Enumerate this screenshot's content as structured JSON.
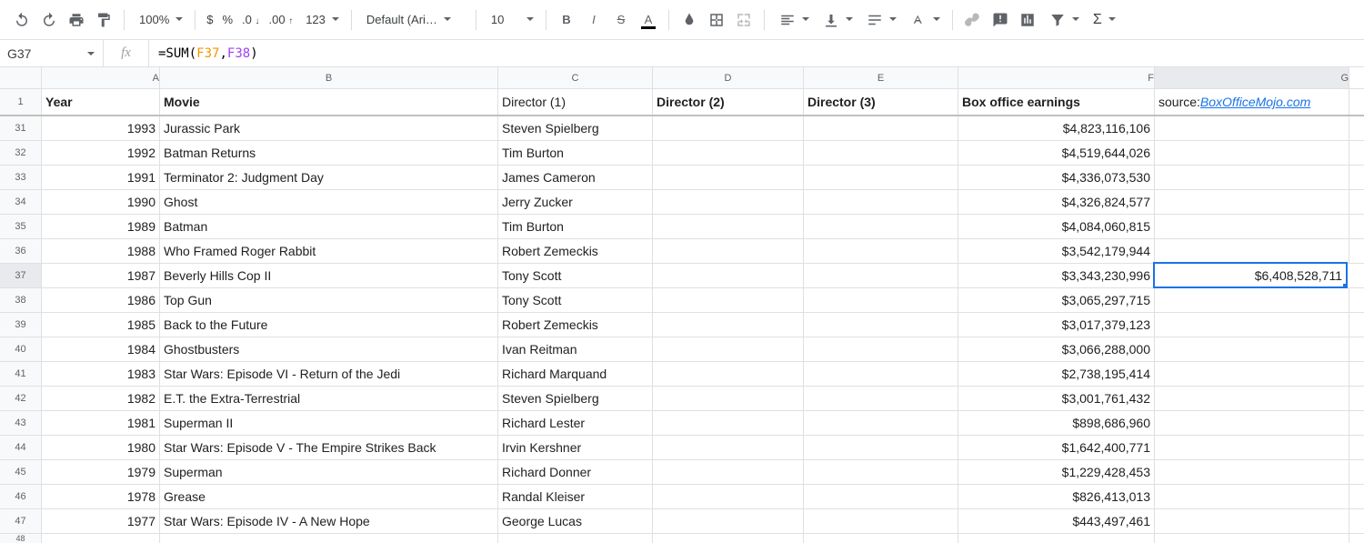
{
  "toolbar": {
    "zoom": "100%",
    "font": "Default (Ari…",
    "fontSize": "10",
    "numberFmt": "123"
  },
  "formulaBar": {
    "cellRef": "G37",
    "prefix": "=SUM(",
    "ref1": "F37",
    "comma": ", ",
    "ref2": "F38",
    "suffix": ")"
  },
  "columns": [
    "A",
    "B",
    "C",
    "D",
    "E",
    "F",
    "G"
  ],
  "headers": {
    "A": "Year",
    "B": "Movie",
    "C": "Director (1)",
    "D": "Director (2)",
    "E": "Director (3)",
    "F": "Box office earnings",
    "G_prefix": "source: ",
    "G_link": "BoxOfficeMojo.com"
  },
  "headerRowNum": "1",
  "rows": [
    {
      "n": "31",
      "year": "1993",
      "movie": "Jurassic Park",
      "d1": "Steven Spielberg",
      "d2": "",
      "d3": "",
      "box": "$4,823,116,106",
      "g": ""
    },
    {
      "n": "32",
      "year": "1992",
      "movie": "Batman Returns",
      "d1": "Tim Burton",
      "d2": "",
      "d3": "",
      "box": "$4,519,644,026",
      "g": ""
    },
    {
      "n": "33",
      "year": "1991",
      "movie": "Terminator 2: Judgment Day",
      "d1": "James Cameron",
      "d2": "",
      "d3": "",
      "box": "$4,336,073,530",
      "g": ""
    },
    {
      "n": "34",
      "year": "1990",
      "movie": "Ghost",
      "d1": "Jerry Zucker",
      "d2": "",
      "d3": "",
      "box": "$4,326,824,577",
      "g": ""
    },
    {
      "n": "35",
      "year": "1989",
      "movie": "Batman",
      "d1": "Tim Burton",
      "d2": "",
      "d3": "",
      "box": "$4,084,060,815",
      "g": ""
    },
    {
      "n": "36",
      "year": "1988",
      "movie": "Who Framed Roger Rabbit",
      "d1": "Robert Zemeckis",
      "d2": "",
      "d3": "",
      "box": "$3,542,179,944",
      "g": ""
    },
    {
      "n": "37",
      "year": "1987",
      "movie": "Beverly Hills Cop II",
      "d1": "Tony Scott",
      "d2": "",
      "d3": "",
      "box": "$3,343,230,996",
      "g": "$6,408,528,711"
    },
    {
      "n": "38",
      "year": "1986",
      "movie": "Top Gun",
      "d1": "Tony Scott",
      "d2": "",
      "d3": "",
      "box": "$3,065,297,715",
      "g": ""
    },
    {
      "n": "39",
      "year": "1985",
      "movie": "Back to the Future",
      "d1": "Robert Zemeckis",
      "d2": "",
      "d3": "",
      "box": "$3,017,379,123",
      "g": ""
    },
    {
      "n": "40",
      "year": "1984",
      "movie": "Ghostbusters",
      "d1": "Ivan Reitman",
      "d2": "",
      "d3": "",
      "box": "$3,066,288,000",
      "g": ""
    },
    {
      "n": "41",
      "year": "1983",
      "movie": "Star Wars: Episode VI - Return of the Jedi",
      "d1": "Richard Marquand",
      "d2": "",
      "d3": "",
      "box": "$2,738,195,414",
      "g": ""
    },
    {
      "n": "42",
      "year": "1982",
      "movie": "E.T. the Extra-Terrestrial",
      "d1": "Steven Spielberg",
      "d2": "",
      "d3": "",
      "box": "$3,001,761,432",
      "g": ""
    },
    {
      "n": "43",
      "year": "1981",
      "movie": "Superman II",
      "d1": "Richard Lester",
      "d2": "",
      "d3": "",
      "box": "$898,686,960",
      "g": ""
    },
    {
      "n": "44",
      "year": "1980",
      "movie": "Star Wars: Episode V - The Empire Strikes Back",
      "d1": "Irvin Kershner",
      "d2": "",
      "d3": "",
      "box": "$1,642,400,771",
      "g": ""
    },
    {
      "n": "45",
      "year": "1979",
      "movie": "Superman",
      "d1": "Richard Donner",
      "d2": "",
      "d3": "",
      "box": "$1,229,428,453",
      "g": ""
    },
    {
      "n": "46",
      "year": "1978",
      "movie": "Grease",
      "d1": "Randal Kleiser",
      "d2": "",
      "d3": "",
      "box": "$826,413,013",
      "g": ""
    },
    {
      "n": "47",
      "year": "1977",
      "movie": "Star Wars: Episode IV - A New Hope",
      "d1": "George Lucas",
      "d2": "",
      "d3": "",
      "box": "$443,497,461",
      "g": ""
    }
  ],
  "selectedRow": "37",
  "partialRow": "48"
}
